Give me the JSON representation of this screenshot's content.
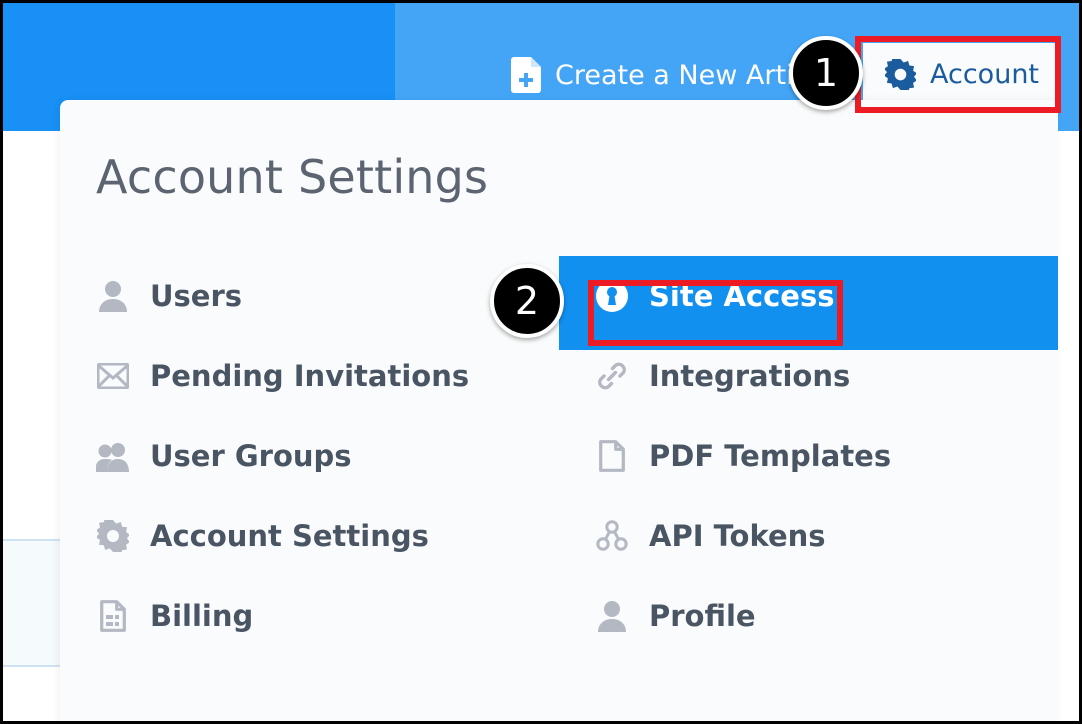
{
  "theme": {
    "header_blue_dark": "#1890f5",
    "header_blue_light": "#44a5f7",
    "highlight_blue": "#1290f0",
    "annotation_red": "#ed1c24",
    "panel_bg": "#fafbfc",
    "title_gray": "#5b6470",
    "label_gray": "#4a5563",
    "icon_gray": "#b3b8c2",
    "account_text_blue": "#1a5c9e"
  },
  "header": {
    "create_article": {
      "label": "Create a New Article",
      "icon": "document-plus-icon"
    },
    "account": {
      "label": "Account",
      "icon": "gear-icon"
    }
  },
  "dropdown": {
    "title": "Account Settings",
    "columns": {
      "left": [
        {
          "label": "Users",
          "icon": "user-icon"
        },
        {
          "label": "Pending Invitations",
          "icon": "envelope-icon"
        },
        {
          "label": "User Groups",
          "icon": "users-group-icon"
        },
        {
          "label": "Account Settings",
          "icon": "gear-icon"
        },
        {
          "label": "Billing",
          "icon": "invoice-icon"
        }
      ],
      "right": [
        {
          "label": "Site Access",
          "icon": "lock-keyhole-icon",
          "active": true
        },
        {
          "label": "Integrations",
          "icon": "link-chain-icon"
        },
        {
          "label": "PDF Templates",
          "icon": "page-icon"
        },
        {
          "label": "API Tokens",
          "icon": "api-nodes-icon"
        },
        {
          "label": "Profile",
          "icon": "user-icon"
        }
      ]
    }
  },
  "annotations": {
    "badges": [
      {
        "number": "1",
        "target": "account-button"
      },
      {
        "number": "2",
        "target": "site-access-menu-item"
      }
    ]
  }
}
